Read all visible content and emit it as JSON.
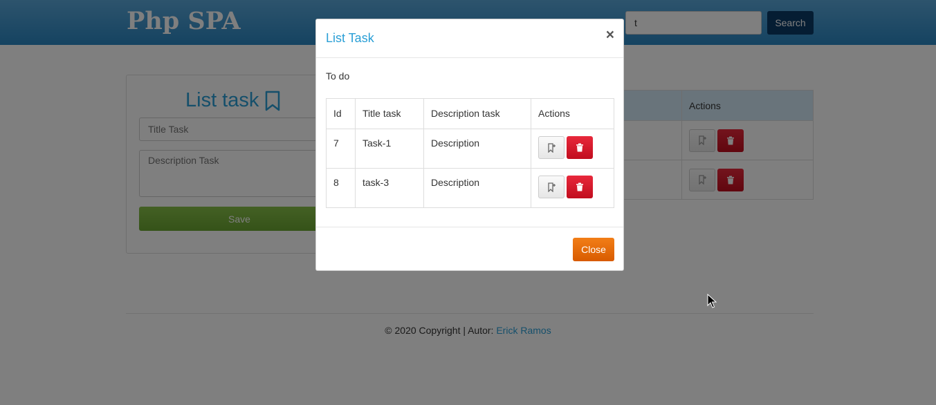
{
  "navbar": {
    "brand": "Php SPA",
    "search_value": "t",
    "search_button": "Search"
  },
  "form": {
    "title": "List task",
    "title_placeholder": "Title Task",
    "description_placeholder": "Description Task",
    "save_label": "Save"
  },
  "background_table": {
    "actions_header": "Actions"
  },
  "footer": {
    "text": "© 2020 Copyright | Autor: ",
    "author": "Erick Ramos"
  },
  "modal": {
    "title": "List Task",
    "close_x": "×",
    "subtitle": "To do",
    "headers": [
      "Id",
      "Title task",
      "Description task",
      "Actions"
    ],
    "rows": [
      {
        "id": "7",
        "title": "Task-1",
        "description": "Description"
      },
      {
        "id": "8",
        "title": "task-3",
        "description": "Description"
      }
    ],
    "close_label": "Close"
  },
  "colors": {
    "accent": "#2a9fd6",
    "navbar": "#2a86c2",
    "save": "#6aa531",
    "delete": "#c10d1e",
    "close": "#d85b00",
    "search_button": "#0b3a66"
  }
}
